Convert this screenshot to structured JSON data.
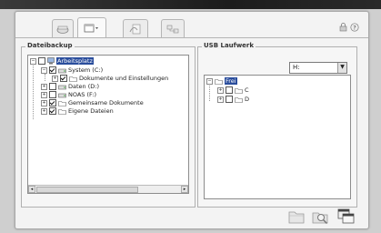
{
  "left_panel": {
    "title": "Dateibackup",
    "tree": [
      {
        "label": "Arbeitsplatz",
        "selected": true
      },
      {
        "label": "System (C:)"
      },
      {
        "label": "Dokumente und Einstellungen"
      },
      {
        "label": "Daten (D:)"
      },
      {
        "label": "NOAS (F:)"
      },
      {
        "label": "Gemeinsame Dokumente"
      },
      {
        "label": "Eigene Dateien"
      }
    ]
  },
  "right_panel": {
    "title": "USB Laufwerk",
    "drive_select": {
      "value": "H:"
    },
    "tree": [
      {
        "label": "Frei"
      },
      {
        "label": "C"
      },
      {
        "label": "D"
      }
    ]
  },
  "icons": {
    "tabs": [
      "backup-tab-icon",
      "restore-tab-icon",
      "sync-tab-icon",
      "network-tab-icon"
    ],
    "top_right": [
      "lock-icon",
      "help-icon"
    ],
    "bottom": [
      "folder-action-icon",
      "magnify-folder-icon",
      "window-copy-icon"
    ]
  }
}
